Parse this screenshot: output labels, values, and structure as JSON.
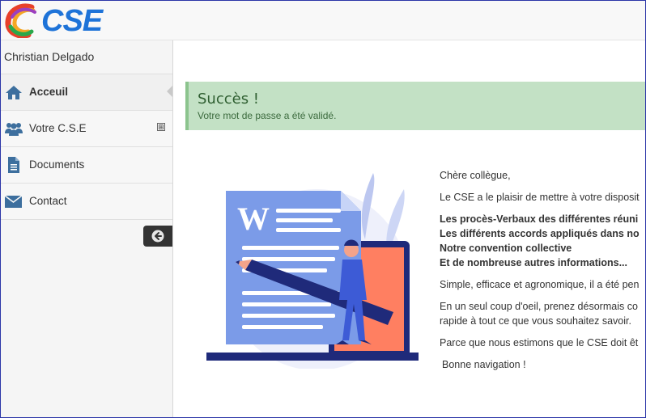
{
  "header": {
    "logo_text": "CSE"
  },
  "sidebar": {
    "user_name": "Christian Delgado",
    "items": [
      {
        "label": "Acceuil",
        "icon": "home-icon"
      },
      {
        "label": "Votre C.S.E",
        "icon": "users-icon",
        "expand_symbol": "⊞"
      },
      {
        "label": "Documents",
        "icon": "document-icon"
      },
      {
        "label": "Contact",
        "icon": "envelope-icon"
      }
    ],
    "collapse_icon": "arrow-left-circle-icon"
  },
  "alert": {
    "title": "Succès !",
    "message": "Votre mot de passe a été validé."
  },
  "content": {
    "greeting": "Chère collègue,",
    "intro": "Le CSE a le plaisir de mettre à votre disposit",
    "bullets": [
      "Les procès-Verbaux des différentes réuni",
      "Les différents accords appliqués dans no",
      "Notre convention collective",
      "Et de nombreuse autres informations..."
    ],
    "p1": "Simple, efficace et agronomique, il a été pen",
    "p2_line1": "En un seul coup d'oeil, prenez désormais co",
    "p2_line2": "rapide à tout ce que vous souhaitez savoir.",
    "p3": "Parce que nous estimons que le CSE doit êt",
    "closing": "Bonne navigation  !"
  },
  "colors": {
    "alert_bg": "#c3e1c5",
    "alert_text": "#2f5f31",
    "icon_blue": "#3d6f9e",
    "logo_blue": "#1e73d8"
  }
}
